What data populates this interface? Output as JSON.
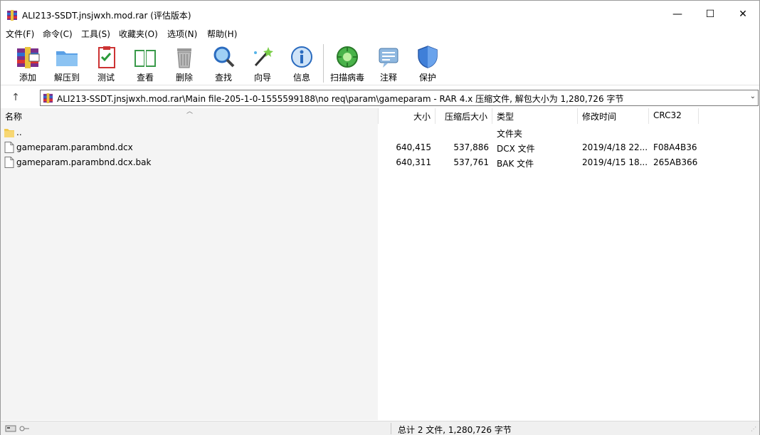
{
  "window": {
    "title": "ALI213-SSDT.jnsjwxh.mod.rar (评估版本)",
    "minimize_glyph": "—",
    "maximize_glyph": "☐",
    "close_glyph": "✕"
  },
  "menu": [
    {
      "label": "文件(F)"
    },
    {
      "label": "命令(C)"
    },
    {
      "label": "工具(S)"
    },
    {
      "label": "收藏夹(O)"
    },
    {
      "label": "选项(N)"
    },
    {
      "label": "帮助(H)"
    }
  ],
  "toolbar": [
    {
      "label": "添加",
      "icon": "winrar-add-icon"
    },
    {
      "label": "解压到",
      "icon": "extract-folder-icon"
    },
    {
      "label": "测试",
      "icon": "test-clipboard-icon"
    },
    {
      "label": "查看",
      "icon": "view-book-icon"
    },
    {
      "label": "删除",
      "icon": "trash-icon"
    },
    {
      "label": "查找",
      "icon": "find-magnifier-icon"
    },
    {
      "label": "向导",
      "icon": "wizard-wand-icon"
    },
    {
      "label": "信息",
      "icon": "info-icon"
    },
    {
      "label": "扫描病毒",
      "icon": "virus-scan-icon"
    },
    {
      "label": "注释",
      "icon": "comment-icon"
    },
    {
      "label": "保护",
      "icon": "shield-icon"
    }
  ],
  "address": {
    "path": "ALI213-SSDT.jnsjwxh.mod.rar\\Main file-205-1-0-1555599188\\no req\\param\\gameparam - RAR 4.x 压缩文件, 解包大小为 1,280,726 字节",
    "up_glyph": "↑",
    "dropdown_glyph": "⌄"
  },
  "columns": {
    "name": "名称",
    "size": "大小",
    "packed": "压缩后大小",
    "type": "类型",
    "modified": "修改时间",
    "crc": "CRC32"
  },
  "rows": [
    {
      "name": "..",
      "size": "",
      "packed": "",
      "type": "文件夹",
      "modified": "",
      "crc": "",
      "icon": "folder-icon"
    },
    {
      "name": "gameparam.parambnd.dcx",
      "size": "640,415",
      "packed": "537,886",
      "type": "DCX 文件",
      "modified": "2019/4/18 22...",
      "crc": "F08A4B36",
      "icon": "file-icon"
    },
    {
      "name": "gameparam.parambnd.dcx.bak",
      "size": "640,311",
      "packed": "537,761",
      "type": "BAK 文件",
      "modified": "2019/4/15 18...",
      "crc": "265AB366",
      "icon": "file-icon"
    }
  ],
  "status": {
    "summary": "总计 2 文件, 1,280,726 字节"
  },
  "colors": {
    "folder": "#f2c94c",
    "accent_blue": "#1e73c8"
  }
}
